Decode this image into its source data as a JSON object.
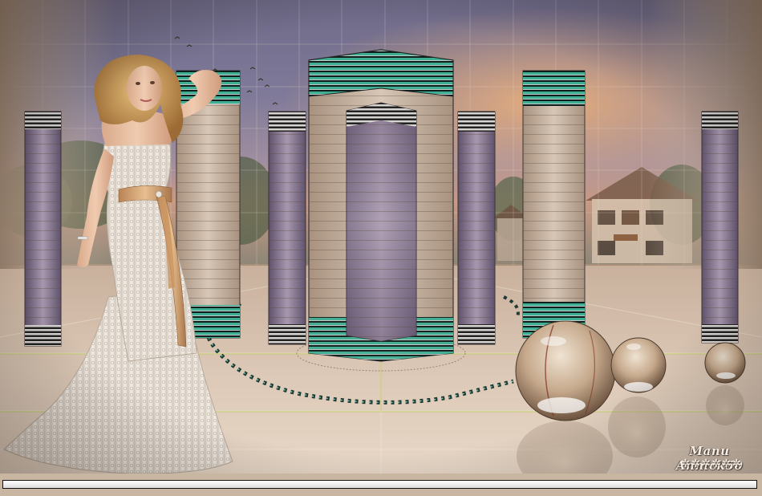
{
  "artwork": {
    "signature": "Manu Annick50",
    "signature_ornament": "✲✲✲✲✲✲",
    "elements": [
      "woman-in-lace-gown",
      "glass-spheres",
      "striped-panels",
      "sunset-sky",
      "house-background",
      "tiled-floor"
    ]
  },
  "colors": {
    "sky_top": "#5a5a7e",
    "sky_mid": "#8a7f9a",
    "sunset_glow": "#d59a70",
    "floor": "#d8c3b0",
    "panel_beige": "#c9b5a2",
    "panel_lilac": "#8a7a93",
    "stripe_teal": "#3aa58a",
    "frame": "#111111"
  }
}
